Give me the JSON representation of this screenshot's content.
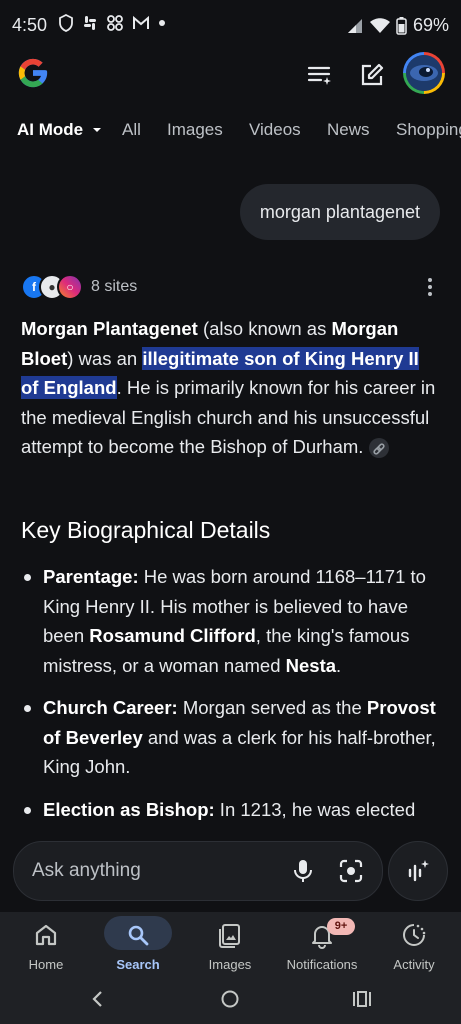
{
  "status": {
    "time": "4:50",
    "battery": "69%",
    "left_icons": [
      "shield-icon",
      "slack-icon",
      "share-icon",
      "gmail-icon",
      "dot-icon"
    ]
  },
  "header": {
    "logo": "google-logo",
    "icons": [
      "history-list-icon",
      "edit-icon",
      "account-avatar"
    ]
  },
  "tabs": [
    {
      "label": "AI Mode",
      "active": true
    },
    {
      "label": "Videos"
    },
    {
      "label": "Images"
    },
    {
      "label": "Videos"
    },
    {
      "label": "News"
    },
    {
      "label": "Shopping"
    }
  ],
  "query": "morgan plantagenet",
  "sources": {
    "count_label": "8 sites",
    "icons": [
      "facebook-icon",
      "site-icon",
      "instagram-icon"
    ]
  },
  "answer": {
    "p1_b1": "Morgan Plantagenet",
    "p1_t1": " (also known as ",
    "p1_b2": "Morgan Bloet",
    "p1_t2": ") was an ",
    "p1_hl": "illegitimate son of King Henry II of England",
    "p1_t3": ". He is primarily known for his career in the medieval English church and his unsuccessful attempt to become the Bishop of Durham."
  },
  "section": {
    "heading": "Key Biographical Details",
    "items": [
      {
        "b1": "Parentage:",
        "t1": " He was born around 1168–1171 to King Henry II. His mother is believed to have been ",
        "b2": "Rosamund Clifford",
        "t2": ", the king's famous mistress, or a woman named ",
        "b3": "Nesta",
        "t3": "."
      },
      {
        "b1": "Church Career:",
        "t1": " Morgan served as the ",
        "b2": "Provost of Beverley",
        "t2": " and was a clerk for his half-brother, King John.",
        "b3": "",
        "t3": ""
      },
      {
        "b1": "Election as Bishop:",
        "t1": " In 1213, he was elected",
        "b2": "",
        "t2": "",
        "b3": "",
        "t3": ""
      }
    ]
  },
  "ask": {
    "placeholder": "Ask anything"
  },
  "bottom_nav": [
    {
      "label": "Home"
    },
    {
      "label": "Search",
      "active": true
    },
    {
      "label": "Images"
    },
    {
      "label": "Notifications",
      "badge": "9+"
    },
    {
      "label": "Activity"
    }
  ],
  "colors": {
    "background": "#101114",
    "highlight": "#1f3a93",
    "active_nav": "#a8c7fa",
    "badge": "#f2b8b5"
  }
}
